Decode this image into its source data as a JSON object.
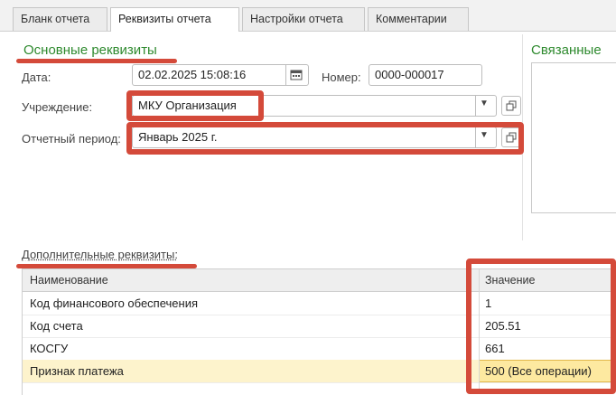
{
  "tabs": [
    {
      "label": "Бланк отчета"
    },
    {
      "label": "Реквизиты отчета"
    },
    {
      "label": "Настройки отчета"
    },
    {
      "label": "Комментарии"
    }
  ],
  "main": {
    "section_title": "Основные реквизиты",
    "date": {
      "label": "Дата:",
      "value": "02.02.2025 15:08:16"
    },
    "number": {
      "label": "Номер:",
      "value": "0000-000017"
    },
    "institution": {
      "label": "Учреждение:",
      "value": "МКУ Организация"
    },
    "period": {
      "label": "Отчетный период:",
      "value": "Январь 2025 г."
    }
  },
  "linked": {
    "section_title": "Связанные"
  },
  "additional": {
    "section_title": "Дополнительные реквизиты:",
    "columns": [
      "Наименование",
      "Значение"
    ],
    "rows": [
      {
        "name": "Код финансового обеспечения",
        "value": "1"
      },
      {
        "name": "Код счета",
        "value": "205.51"
      },
      {
        "name": "КОСГУ",
        "value": "661"
      },
      {
        "name": "Признак платежа",
        "value": "500 (Все операции)"
      }
    ]
  },
  "colors": {
    "section_green": "#2e8a2e",
    "annotation_red": "#d44a3a",
    "highlight_row": "#fdf3cc"
  }
}
